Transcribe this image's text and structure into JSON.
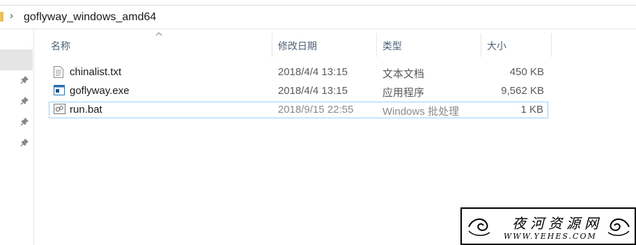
{
  "address_bar": {
    "separator": "›",
    "path": "goflyway_windows_amd64"
  },
  "columns": {
    "name": "名称",
    "modified": "修改日期",
    "type": "类型",
    "size": "大小"
  },
  "files": [
    {
      "name": "chinalist.txt",
      "modified": "2018/4/4 13:15",
      "type": "文本文档",
      "size": "450 KB",
      "icon": "text-file-icon"
    },
    {
      "name": "goflyway.exe",
      "modified": "2018/4/4 13:15",
      "type": "应用程序",
      "size": "9,562 KB",
      "icon": "exe-file-icon"
    },
    {
      "name": "run.bat",
      "modified": "2018/9/15 22:55",
      "type": "Windows 批处理",
      "size": "1 KB",
      "icon": "batch-file-icon"
    }
  ],
  "watermark": {
    "title": "夜河资源网",
    "url": "WWW.YEHES.COM"
  },
  "colors": {
    "focus_border": "#99d1ff",
    "header_text": "#4c607a",
    "nav_selected": "#e5e5e5"
  }
}
